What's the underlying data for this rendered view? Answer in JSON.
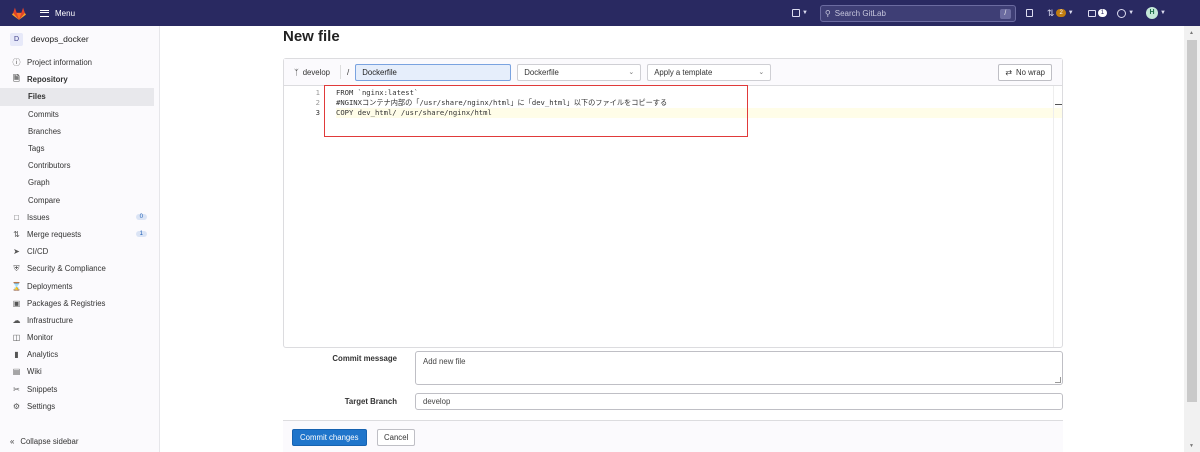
{
  "topbar": {
    "menu_label": "Menu",
    "search_placeholder": "Search GitLab",
    "search_shortcut": "/",
    "merge_requests_count": "2",
    "todos_count": "1",
    "avatar_initial": "H"
  },
  "sidebar": {
    "project_initial": "D",
    "project_name": "devops_docker",
    "items": [
      {
        "label": "Project information",
        "icon": "info-icon"
      },
      {
        "label": "Repository",
        "icon": "repository-icon"
      },
      {
        "label": "Files"
      },
      {
        "label": "Commits"
      },
      {
        "label": "Branches"
      },
      {
        "label": "Tags"
      },
      {
        "label": "Contributors"
      },
      {
        "label": "Graph"
      },
      {
        "label": "Compare"
      },
      {
        "label": "Issues",
        "icon": "issues-icon",
        "count": "0"
      },
      {
        "label": "Merge requests",
        "icon": "merge-request-icon",
        "count": "1"
      },
      {
        "label": "CI/CD",
        "icon": "rocket-icon"
      },
      {
        "label": "Security & Compliance",
        "icon": "shield-icon"
      },
      {
        "label": "Deployments",
        "icon": "deployments-icon"
      },
      {
        "label": "Packages & Registries",
        "icon": "package-icon"
      },
      {
        "label": "Infrastructure",
        "icon": "cloud-icon"
      },
      {
        "label": "Monitor",
        "icon": "monitor-icon"
      },
      {
        "label": "Analytics",
        "icon": "chart-icon"
      },
      {
        "label": "Wiki",
        "icon": "book-icon"
      },
      {
        "label": "Snippets",
        "icon": "snippet-icon"
      },
      {
        "label": "Settings",
        "icon": "gear-icon"
      }
    ],
    "collapse_label": "Collapse sidebar"
  },
  "main": {
    "title": "New file",
    "branch": "develop",
    "path_separator": "/",
    "filename": "Dockerfile",
    "file_type_select": "Dockerfile",
    "template_select": "Apply a template",
    "nowrap_label": "No wrap",
    "code_lines": [
      {
        "num": "1",
        "text": "FROM `nginx:latest`"
      },
      {
        "num": "2",
        "text": "#NGINXコンテナ内部の「/usr/share/nginx/html」に「dev_html」以下のファイルをコピーする"
      },
      {
        "num": "3",
        "text": "COPY dev_html/ /usr/share/nginx/html"
      }
    ],
    "commit_message_label": "Commit message",
    "commit_message_value": "Add new file",
    "target_branch_label": "Target Branch",
    "target_branch_value": "develop",
    "commit_button": "Commit changes",
    "cancel_button": "Cancel"
  },
  "colors": {
    "navbar": "#292961",
    "primary": "#1f75cb",
    "highlight_box": "#e03a3a"
  }
}
